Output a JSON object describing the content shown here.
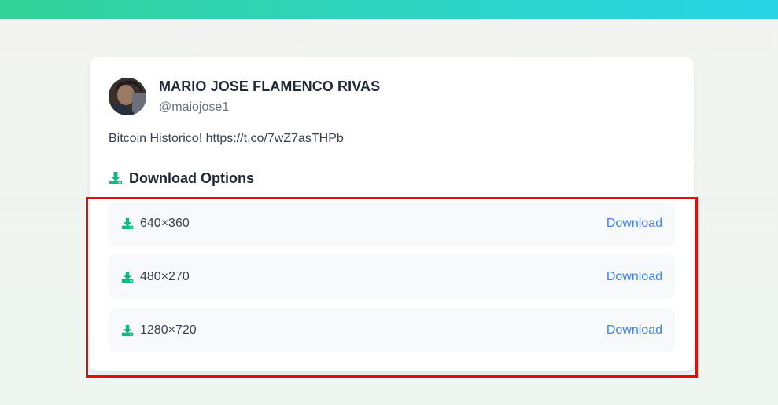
{
  "profile": {
    "name": "MARIO JOSE FLAMENCO RIVAS",
    "handle": "@maiojose1",
    "avatar_icon": "user-avatar-photo"
  },
  "tweet": {
    "text": "Bitcoin Historico! https://t.co/7wZ7asTHPb"
  },
  "downloads": {
    "title": "Download Options",
    "icon": "download-icon",
    "options": [
      {
        "resolution": "640×360",
        "link_label": "Download"
      },
      {
        "resolution": "480×270",
        "link_label": "Download"
      },
      {
        "resolution": "1280×720",
        "link_label": "Download"
      }
    ]
  },
  "colors": {
    "accent_green": "#10b981",
    "link_blue": "#3b82f6",
    "highlight_red": "#e20d0d",
    "header_gradient_start": "#34d399",
    "header_gradient_end": "#27d4e6"
  }
}
